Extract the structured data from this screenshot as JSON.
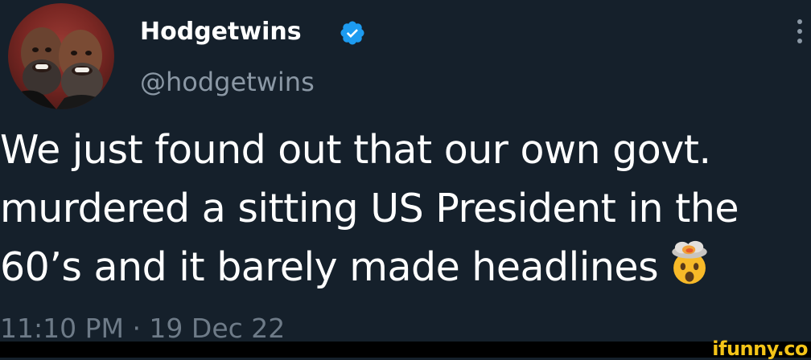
{
  "tweet": {
    "display_name": "Hodgetwins",
    "handle": "@hodgetwins",
    "verified": true,
    "text_lines": [
      "We just found out that our own govt.",
      "murdered a sitting US President in the",
      "60’s and it barely made headlines"
    ],
    "emoji": "exploding-head",
    "timestamp": "11:10 PM · 19 Dec 22"
  },
  "watermark": {
    "text": "ifunny.co"
  },
  "colors": {
    "background": "#15202b",
    "text": "#ffffff",
    "secondary": "#8b98a5",
    "verified": "#1d9bf0",
    "watermark": "#f5c518"
  }
}
